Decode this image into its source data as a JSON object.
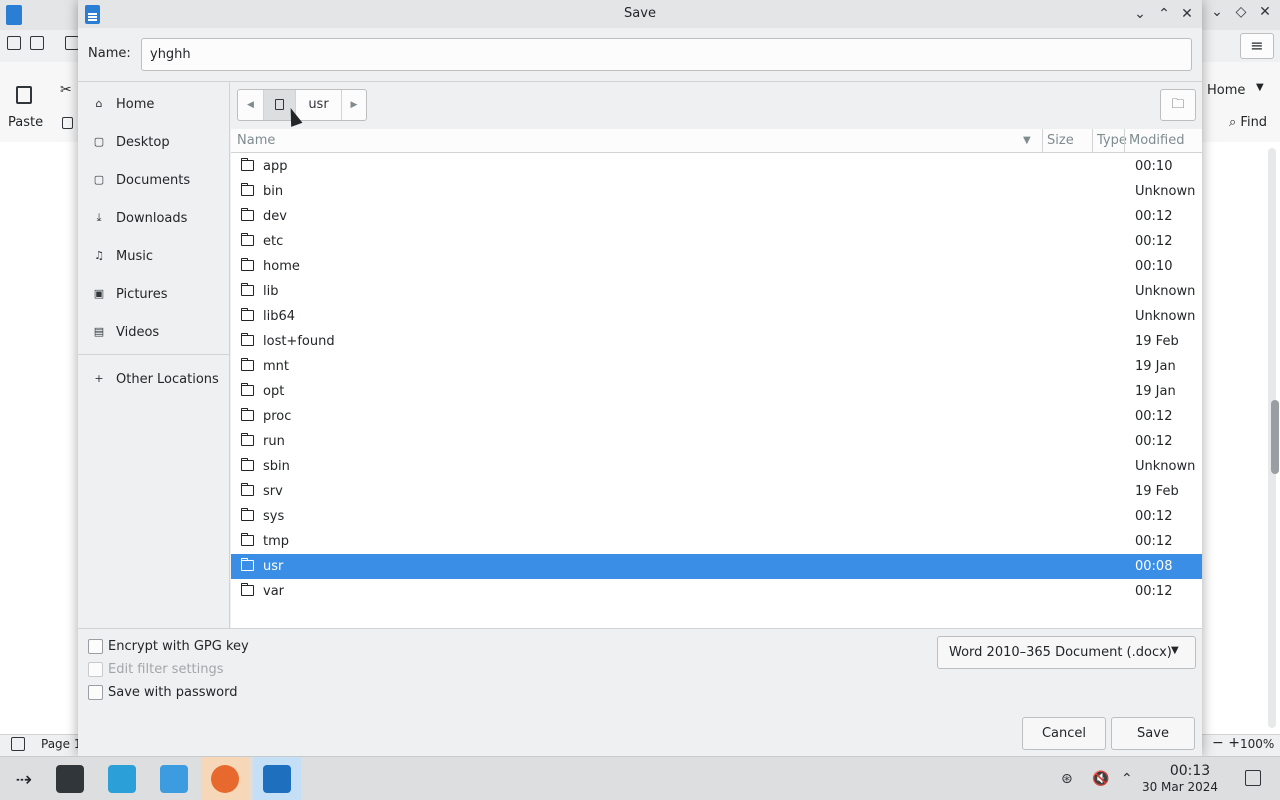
{
  "background_app": {
    "page_label": "Page 1",
    "paste_label": "Paste",
    "home_tab_label": "Home",
    "find_label": "Find",
    "zoom_label": "100%",
    "zoom_minus": "−",
    "zoom_plus": "+"
  },
  "dialog": {
    "title": "Save",
    "name_label": "Name:",
    "name_value": "yhghh",
    "sidebar": [
      {
        "label": "Home",
        "icon": "home-icon"
      },
      {
        "label": "Desktop",
        "icon": "desktop-icon"
      },
      {
        "label": "Documents",
        "icon": "documents-icon"
      },
      {
        "label": "Downloads",
        "icon": "downloads-icon"
      },
      {
        "label": "Music",
        "icon": "music-icon"
      },
      {
        "label": "Pictures",
        "icon": "pictures-icon"
      },
      {
        "label": "Videos",
        "icon": "videos-icon"
      }
    ],
    "other_locations_label": "Other Locations",
    "path": {
      "current": "usr"
    },
    "columns": {
      "name": "Name",
      "size": "Size",
      "type": "Type",
      "modified": "Modified"
    },
    "files": [
      {
        "name": "app",
        "modified": "00:10"
      },
      {
        "name": "bin",
        "modified": "Unknown"
      },
      {
        "name": "dev",
        "modified": "00:12"
      },
      {
        "name": "etc",
        "modified": "00:12"
      },
      {
        "name": "home",
        "modified": "00:10"
      },
      {
        "name": "lib",
        "modified": "Unknown"
      },
      {
        "name": "lib64",
        "modified": "Unknown"
      },
      {
        "name": "lost+found",
        "modified": "19 Feb"
      },
      {
        "name": "mnt",
        "modified": "19 Jan"
      },
      {
        "name": "opt",
        "modified": "19 Jan"
      },
      {
        "name": "proc",
        "modified": "00:12"
      },
      {
        "name": "run",
        "modified": "00:12"
      },
      {
        "name": "sbin",
        "modified": "Unknown"
      },
      {
        "name": "srv",
        "modified": "19 Feb"
      },
      {
        "name": "sys",
        "modified": "00:12"
      },
      {
        "name": "tmp",
        "modified": "00:12"
      },
      {
        "name": "usr",
        "modified": "00:08",
        "selected": true
      },
      {
        "name": "var",
        "modified": "00:12"
      }
    ],
    "options": {
      "encrypt_gpg": "Encrypt with GPG key",
      "edit_filter": "Edit filter settings",
      "save_password": "Save with password"
    },
    "file_type": "Word 2010–365 Document (.docx)",
    "cancel_label": "Cancel",
    "save_label": "Save"
  },
  "taskbar": {
    "time": "00:13",
    "date": "30 Mar 2024"
  },
  "colors": {
    "selection": "#3a8ee6",
    "accent": "#2a7fd4"
  }
}
